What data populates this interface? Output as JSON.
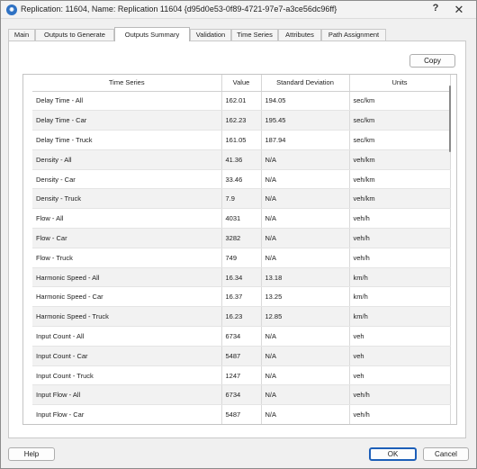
{
  "window": {
    "title": "Replication: 11604, Name: Replication 11604  {d95d0e53-0f89-4721-97e7-a3ce56dc96ff}",
    "help_glyph": "?",
    "close_glyph": "✕",
    "icon": "app-logo-icon"
  },
  "tabs": [
    {
      "label": "Main"
    },
    {
      "label": "Outputs to Generate"
    },
    {
      "label": "Outputs Summary"
    },
    {
      "label": "Validation"
    },
    {
      "label": "Time Series"
    },
    {
      "label": "Attributes"
    },
    {
      "label": "Path Assignment"
    }
  ],
  "active_tab": "Outputs Summary",
  "copy_label": "Copy",
  "table": {
    "headers": [
      "Time Series",
      "Value",
      "Standard Deviation",
      "Units"
    ],
    "rows": [
      [
        "Delay Time - All",
        "162.01",
        "194.05",
        "sec/km"
      ],
      [
        "Delay Time - Car",
        "162.23",
        "195.45",
        "sec/km"
      ],
      [
        "Delay Time - Truck",
        "161.05",
        "187.94",
        "sec/km"
      ],
      [
        "Density - All",
        "41.36",
        "N/A",
        "veh/km"
      ],
      [
        "Density - Car",
        "33.46",
        "N/A",
        "veh/km"
      ],
      [
        "Density - Truck",
        "7.9",
        "N/A",
        "veh/km"
      ],
      [
        "Flow - All",
        "4031",
        "N/A",
        "veh/h"
      ],
      [
        "Flow - Car",
        "3282",
        "N/A",
        "veh/h"
      ],
      [
        "Flow - Truck",
        "749",
        "N/A",
        "veh/h"
      ],
      [
        "Harmonic Speed - All",
        "16.34",
        "13.18",
        "km/h"
      ],
      [
        "Harmonic Speed - Car",
        "16.37",
        "13.25",
        "km/h"
      ],
      [
        "Harmonic Speed - Truck",
        "16.23",
        "12.85",
        "km/h"
      ],
      [
        "Input Count - All",
        "6734",
        "N/A",
        "veh"
      ],
      [
        "Input Count - Car",
        "5487",
        "N/A",
        "veh"
      ],
      [
        "Input Count - Truck",
        "1247",
        "N/A",
        "veh"
      ],
      [
        "Input Flow - All",
        "6734",
        "N/A",
        "veh/h"
      ],
      [
        "Input Flow - Car",
        "5487",
        "N/A",
        "veh/h"
      ]
    ]
  },
  "buttons": {
    "help": "Help",
    "ok": "OK",
    "cancel": "Cancel"
  },
  "colors": {
    "accent": "#1d5fb8",
    "app_icon": "#2f72c4",
    "row_alt": "#f2f2f2"
  }
}
